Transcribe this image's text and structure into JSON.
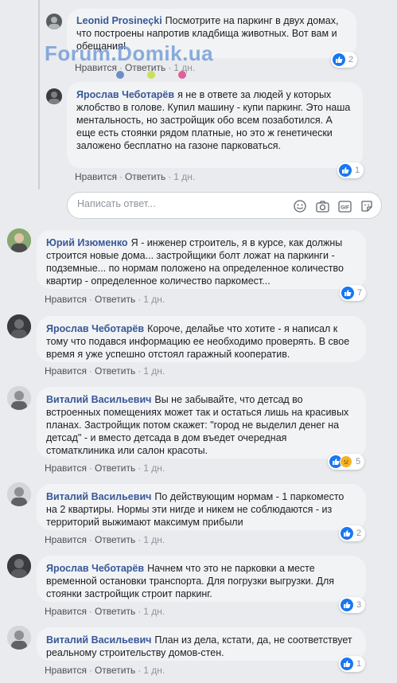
{
  "watermark": {
    "text": "Forum.Domik.ua",
    "dot_colors": [
      "#6a8fc8",
      "#c9e05a",
      "#e0609a"
    ]
  },
  "actions": {
    "like": "Нравится",
    "reply": "Ответить"
  },
  "reply_box": {
    "placeholder": "Написать ответ..."
  },
  "comments": [
    {
      "author": "Leonid Prosineçki",
      "text": "Посмотрите на паркинг в двух домах, что построены напротив кладбища животных. Вот вам и обещания!",
      "time": "1 дн.",
      "likes": "2",
      "reactions": [
        "like"
      ]
    },
    {
      "author": "Ярослав Чеботарёв",
      "text": "я не в ответе за людей у которых жлобство в голове. Купил машину - купи паркинг. Это наша ментальность, но застройщик обо всем позаботился. А еще есть стоянки рядом платные, но это ж генетически заложено бесплатно на газоне парковаться.",
      "time": "1 дн.",
      "likes": "1",
      "reactions": [
        "like"
      ]
    },
    {
      "author": "Юрий Изюменко",
      "text": "Я - инженер строитель, я в курсе, как должны строится новые дома... застройщики болт ложат на паркинги - подземные... по нормам положено на определенное количество квартир - определенное количество паркомест...",
      "time": "1 дн.",
      "likes": "7",
      "reactions": [
        "like"
      ]
    },
    {
      "author": "Ярослав Чеботарёв",
      "text": "Короче, делайье что хотите - я написал к тому что подався информацию ее необходимо проверять. В свое время я уже успешно отстоял гаражный кооператив.",
      "time": "1 дн.",
      "likes": "",
      "reactions": []
    },
    {
      "author": "Виталий Васильевич",
      "text": "Вы не забывайте, что детсад во встроенных помещениях может так и остаться лишь на красивых планах. Застройщик потом скажет: \"город не выделил денег на детсад\" - и вместо детсада в дом въедет очередная стоматклиника или салон красоты.",
      "time": "1 дн.",
      "likes": "5",
      "reactions": [
        "like",
        "sad"
      ]
    },
    {
      "author": "Виталий Васильевич",
      "text": "По действующим нормам - 1 паркоместо на 2 квартиры. Нормы эти нигде и никем не соблюдаются - из территорий выжимают максимум прибыли",
      "time": "1 дн.",
      "likes": "2",
      "reactions": [
        "like"
      ]
    },
    {
      "author": "Ярослав Чеботарёв",
      "text": "Начнем что это не парковки а месте временной остановки транспорта. Для погрузки выгрузки. Для стоянки застройщик строит паркинг.",
      "time": "1 дн.",
      "likes": "3",
      "reactions": [
        "like"
      ]
    },
    {
      "author": "Виталий Васильевич",
      "text": "План из дела, кстати, да, не соответствует реальному строительству домов-стен.",
      "time": "1 дн.",
      "likes": "1",
      "reactions": [
        "like"
      ]
    }
  ],
  "icons": {
    "like": "thumbs-up-icon",
    "sad": "sad-face-icon",
    "emoji": "smiley-icon",
    "camera": "camera-icon",
    "gif": "gif-icon",
    "sticker": "sticker-icon"
  },
  "colors": {
    "author": "#385898",
    "like_blue": "#1877f2",
    "bubble": "#f2f3f5",
    "page_bg": "#e9ebee"
  }
}
